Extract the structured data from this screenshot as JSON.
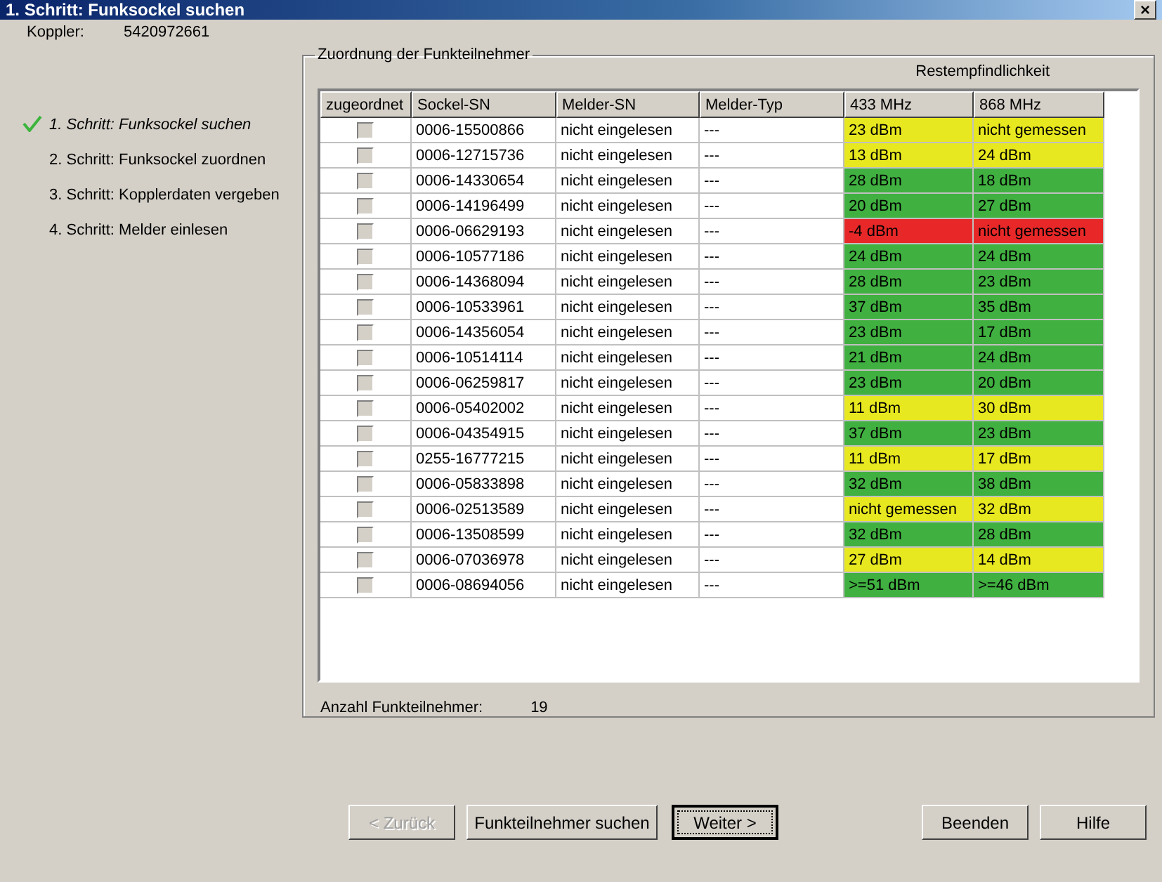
{
  "window": {
    "title": "1. Schritt: Funksockel suchen",
    "close": "×"
  },
  "coupler": {
    "label": "Koppler:",
    "value": "5420972661"
  },
  "steps": [
    {
      "label": "1. Schritt: Funksockel suchen",
      "selected": true
    },
    {
      "label": "2. Schritt: Funksockel zuordnen",
      "selected": false
    },
    {
      "label": "3. Schritt: Kopplerdaten vergeben",
      "selected": false
    },
    {
      "label": "4. Schritt: Melder einlesen",
      "selected": false
    }
  ],
  "group": {
    "title": "Zuordnung der Funkteilnehmer",
    "header_group": "Restempfindlichkeit",
    "table": {
      "columns": [
        "zugeordnet",
        "Sockel-SN",
        "Melder-SN",
        "Melder-Typ",
        "433 MHz",
        "868 MHz"
      ],
      "rows": [
        {
          "checked": false,
          "sockel": "0006-15500866",
          "melder": "nicht eingelesen",
          "typ": "---",
          "f433": {
            "text": "23 dBm",
            "color": "#e8e820"
          },
          "f868": {
            "text": "nicht gemessen",
            "color": "#e8e820"
          }
        },
        {
          "checked": false,
          "sockel": "0006-12715736",
          "melder": "nicht eingelesen",
          "typ": "---",
          "f433": {
            "text": "13 dBm",
            "color": "#e8e820"
          },
          "f868": {
            "text": "24 dBm",
            "color": "#e8e820"
          }
        },
        {
          "checked": false,
          "sockel": "0006-14330654",
          "melder": "nicht eingelesen",
          "typ": "---",
          "f433": {
            "text": "28 dBm",
            "color": "#40b040"
          },
          "f868": {
            "text": "18 dBm",
            "color": "#40b040"
          }
        },
        {
          "checked": false,
          "sockel": "0006-14196499",
          "melder": "nicht eingelesen",
          "typ": "---",
          "f433": {
            "text": "20 dBm",
            "color": "#40b040"
          },
          "f868": {
            "text": "27 dBm",
            "color": "#40b040"
          }
        },
        {
          "checked": false,
          "sockel": "0006-06629193",
          "melder": "nicht eingelesen",
          "typ": "---",
          "f433": {
            "text": "-4 dBm",
            "color": "#e82828"
          },
          "f868": {
            "text": "nicht gemessen",
            "color": "#e82828"
          }
        },
        {
          "checked": false,
          "sockel": "0006-10577186",
          "melder": "nicht eingelesen",
          "typ": "---",
          "f433": {
            "text": "24 dBm",
            "color": "#40b040"
          },
          "f868": {
            "text": "24 dBm",
            "color": "#40b040"
          }
        },
        {
          "checked": false,
          "sockel": "0006-14368094",
          "melder": "nicht eingelesen",
          "typ": "---",
          "f433": {
            "text": "28 dBm",
            "color": "#40b040"
          },
          "f868": {
            "text": "23 dBm",
            "color": "#40b040"
          }
        },
        {
          "checked": false,
          "sockel": "0006-10533961",
          "melder": "nicht eingelesen",
          "typ": "---",
          "f433": {
            "text": "37 dBm",
            "color": "#40b040"
          },
          "f868": {
            "text": "35 dBm",
            "color": "#40b040"
          }
        },
        {
          "checked": false,
          "sockel": "0006-14356054",
          "melder": "nicht eingelesen",
          "typ": "---",
          "f433": {
            "text": "23 dBm",
            "color": "#40b040"
          },
          "f868": {
            "text": "17 dBm",
            "color": "#40b040"
          }
        },
        {
          "checked": false,
          "sockel": "0006-10514114",
          "melder": "nicht eingelesen",
          "typ": "---",
          "f433": {
            "text": "21 dBm",
            "color": "#40b040"
          },
          "f868": {
            "text": "24 dBm",
            "color": "#40b040"
          }
        },
        {
          "checked": false,
          "sockel": "0006-06259817",
          "melder": "nicht eingelesen",
          "typ": "---",
          "f433": {
            "text": "23 dBm",
            "color": "#40b040"
          },
          "f868": {
            "text": "20 dBm",
            "color": "#40b040"
          }
        },
        {
          "checked": false,
          "sockel": "0006-05402002",
          "melder": "nicht eingelesen",
          "typ": "---",
          "f433": {
            "text": "11 dBm",
            "color": "#e8e820"
          },
          "f868": {
            "text": "30 dBm",
            "color": "#e8e820"
          }
        },
        {
          "checked": false,
          "sockel": "0006-04354915",
          "melder": "nicht eingelesen",
          "typ": "---",
          "f433": {
            "text": "37 dBm",
            "color": "#40b040"
          },
          "f868": {
            "text": "23 dBm",
            "color": "#40b040"
          }
        },
        {
          "checked": false,
          "sockel": "0255-16777215",
          "melder": "nicht eingelesen",
          "typ": "---",
          "f433": {
            "text": "11 dBm",
            "color": "#e8e820"
          },
          "f868": {
            "text": "17 dBm",
            "color": "#e8e820"
          }
        },
        {
          "checked": false,
          "sockel": "0006-05833898",
          "melder": "nicht eingelesen",
          "typ": "---",
          "f433": {
            "text": "32 dBm",
            "color": "#40b040"
          },
          "f868": {
            "text": "38 dBm",
            "color": "#40b040"
          }
        },
        {
          "checked": false,
          "sockel": "0006-02513589",
          "melder": "nicht eingelesen",
          "typ": "---",
          "f433": {
            "text": "nicht gemessen",
            "color": "#e8e820"
          },
          "f868": {
            "text": "32 dBm",
            "color": "#e8e820"
          }
        },
        {
          "checked": false,
          "sockel": "0006-13508599",
          "melder": "nicht eingelesen",
          "typ": "---",
          "f433": {
            "text": "32 dBm",
            "color": "#40b040"
          },
          "f868": {
            "text": "28 dBm",
            "color": "#40b040"
          }
        },
        {
          "checked": false,
          "sockel": "0006-07036978",
          "melder": "nicht eingelesen",
          "typ": "---",
          "f433": {
            "text": "27 dBm",
            "color": "#e8e820"
          },
          "f868": {
            "text": "14 dBm",
            "color": "#e8e820"
          }
        },
        {
          "checked": false,
          "sockel": "0006-08694056",
          "melder": "nicht eingelesen",
          "typ": "---",
          "f433": {
            "text": ">=51 dBm",
            "color": "#40b040"
          },
          "f868": {
            "text": ">=46 dBm",
            "color": "#40b040"
          }
        }
      ]
    },
    "count": {
      "label": "Anzahl Funkteilnehmer:",
      "value": "19"
    }
  },
  "buttons": [
    {
      "label": "< Zurück",
      "disabled": true,
      "focused": false
    },
    {
      "label": "Funkteilnehmer suchen",
      "disabled": false,
      "focused": false
    },
    {
      "label": "Weiter >",
      "disabled": false,
      "focused": true
    },
    {
      "label": "Beenden",
      "disabled": false,
      "focused": false
    },
    {
      "label": "Hilfe",
      "disabled": false,
      "focused": false
    }
  ]
}
